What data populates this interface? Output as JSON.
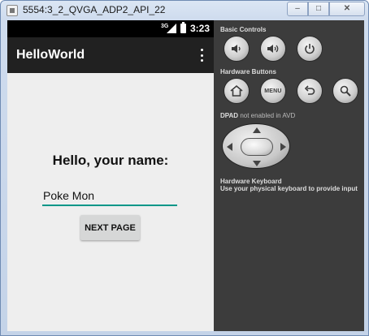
{
  "window": {
    "title": "5554:3_2_QVGA_ADP2_API_22",
    "minimize_glyph": "–",
    "maximize_glyph": "□",
    "close_glyph": "✕"
  },
  "device": {
    "status_bar": {
      "network": "3G",
      "time": "3:23"
    },
    "action_bar": {
      "title": "HelloWorld",
      "overflow_icon": "more-vert-icon"
    },
    "content": {
      "greeting": "Hello, your name:",
      "name_input_value": "Poke Mon",
      "next_button_label": "NEXT PAGE"
    },
    "accent_color": "#009688"
  },
  "controls": {
    "basic_label": "Basic Controls",
    "hardware_buttons_label": "Hardware Buttons",
    "menu_label": "MENU",
    "dpad_label": "DPAD",
    "dpad_note": "not enabled in AVD",
    "keyboard_label": "Hardware Keyboard",
    "keyboard_note": "Use your physical keyboard to provide input",
    "icons": [
      "volume-down-icon",
      "volume-up-icon",
      "power-icon",
      "home-icon",
      "menu-icon",
      "back-icon",
      "search-icon"
    ]
  }
}
